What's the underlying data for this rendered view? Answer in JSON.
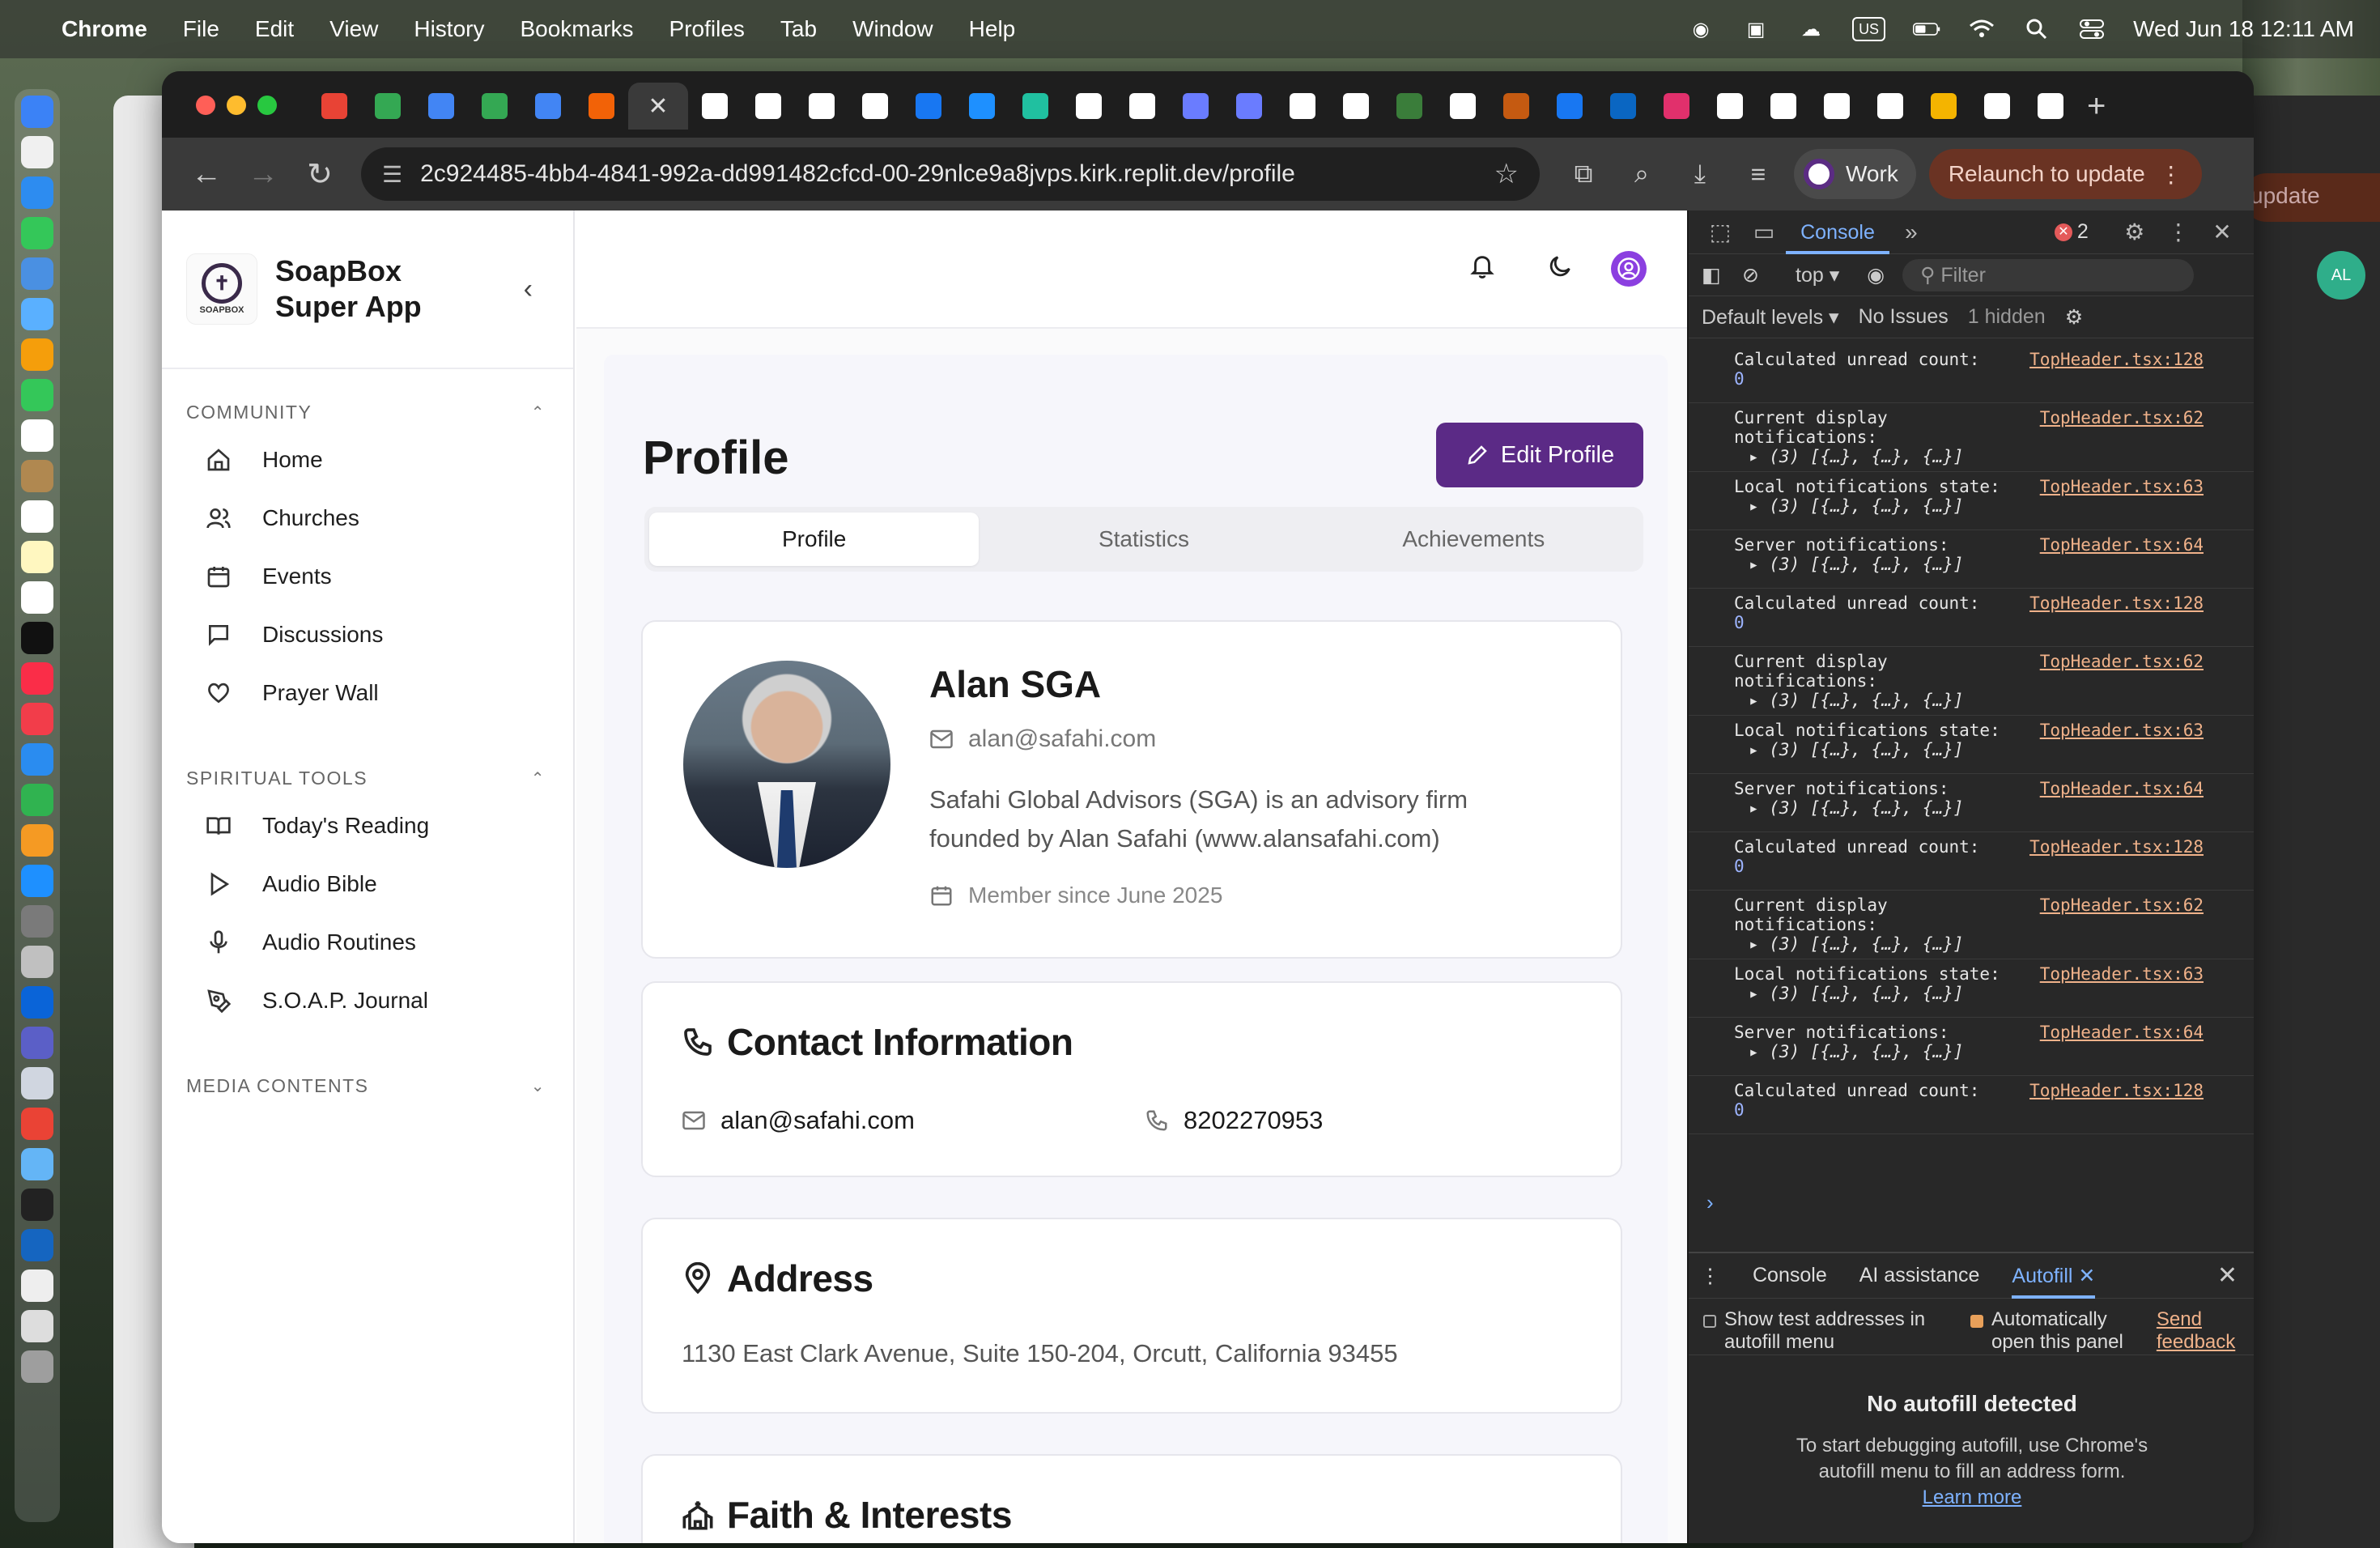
{
  "menubar": {
    "app": "Chrome",
    "items": [
      "File",
      "Edit",
      "View",
      "History",
      "Bookmarks",
      "Profiles",
      "Tab",
      "Window",
      "Help"
    ],
    "input_source": "US",
    "clock": "Wed Jun 18  12:11 AM"
  },
  "browser": {
    "url": "2c924485-4bb4-4841-992a-dd991482cfcd-00-29nlce9a8jvps.kirk.replit.dev/profile",
    "profile_chip": "Work",
    "relaunch": "Relaunch to update",
    "bg_window_update": "update",
    "bg_window_avatar": "AL",
    "tab_icons": [
      "gmail-icon",
      "sheets-icon",
      "docs-icon",
      "sheets-icon",
      "docs-icon",
      "replit-icon",
      "active-tab",
      "chatgpt-icon",
      "github-icon",
      "chatgpt-icon",
      "x-icon",
      "facebook-icon",
      "stack-icon",
      "replit-icon",
      "google-icon",
      "chatgpt-icon",
      "chatgpt-icon",
      "chatgpt-icon",
      "github-icon",
      "google-icon",
      "app-icon",
      "app-icon",
      "app-icon",
      "facebook-icon",
      "linkedin-icon",
      "instagram-icon",
      "google-icon",
      "google-icon",
      "amazon-icon",
      "x-icon",
      "app-icon",
      "chrome-icon",
      "app-icon"
    ],
    "tab_colors": [
      "#e84335",
      "#34a853",
      "#4285f4",
      "#34a853",
      "#4285f4",
      "#f26207",
      "#3a3a3a",
      "#ffffff",
      "#ffffff",
      "#ffffff",
      "#ffffff",
      "#1877f2",
      "#1e90ff",
      "#20c0a0",
      "#ffffff",
      "#ffffff",
      "#6a7cff",
      "#6a7cff",
      "#ffffff",
      "#ffffff",
      "#3a7d3a",
      "#ffffff",
      "#c55a11",
      "#1877f2",
      "#0a66c2",
      "#e1306c",
      "#ffffff",
      "#ffffff",
      "#ffffff",
      "#ffffff",
      "#f4b400",
      "#ffffff",
      "#ffffff"
    ]
  },
  "app": {
    "brand_line1": "SoapBox",
    "brand_line2": "Super App",
    "logo_text": "SOAPBOX",
    "sections": [
      {
        "title": "COMMUNITY",
        "items": [
          "Home",
          "Churches",
          "Events",
          "Discussions",
          "Prayer Wall"
        ]
      },
      {
        "title": "SPIRITUAL TOOLS",
        "items": [
          "Today's Reading",
          "Audio Bible",
          "Audio Routines",
          "S.O.A.P. Journal"
        ]
      },
      {
        "title": "MEDIA CONTENTS",
        "items": []
      }
    ]
  },
  "profile": {
    "page_title": "Profile",
    "edit_button": "Edit Profile",
    "tabs": [
      "Profile",
      "Statistics",
      "Achievements"
    ],
    "name": "Alan SGA",
    "email": "alan@safahi.com",
    "bio": "Safahi Global Advisors (SGA) is an advisory firm founded by Alan Safahi (www.alansafahi.com)",
    "member_since": "Member since June 2025",
    "contact_title": "Contact Information",
    "contact_email": "alan@safahi.com",
    "contact_phone": "8202270953",
    "address_title": "Address",
    "address": "1130 East Clark Avenue, Suite 150-204, Orcutt, California 93455",
    "faith_title": "Faith & Interests"
  },
  "devtools": {
    "tab": "Console",
    "error_count": "2",
    "context": "top",
    "filter_placeholder": "Filter",
    "levels": "Default levels",
    "issues": "No Issues",
    "hidden": "1 hidden",
    "logs": [
      {
        "msg": "Calculated unread count:",
        "src": "TopHeader.tsx:128",
        "val": "0"
      },
      {
        "msg": "Current display\nnotifications:",
        "src": "TopHeader.tsx:62",
        "sub": "▸ (3) [{…}, {…}, {…}]"
      },
      {
        "msg": "Local notifications state:",
        "src": "TopHeader.tsx:63",
        "sub": "▸ (3) [{…}, {…}, {…}]"
      },
      {
        "msg": "Server notifications:",
        "src": "TopHeader.tsx:64",
        "sub": "▸ (3) [{…}, {…}, {…}]"
      },
      {
        "msg": "Calculated unread count:",
        "src": "TopHeader.tsx:128",
        "val": "0"
      },
      {
        "msg": "Current display\nnotifications:",
        "src": "TopHeader.tsx:62",
        "sub": "▸ (3) [{…}, {…}, {…}]"
      },
      {
        "msg": "Local notifications state:",
        "src": "TopHeader.tsx:63",
        "sub": "▸ (3) [{…}, {…}, {…}]"
      },
      {
        "msg": "Server notifications:",
        "src": "TopHeader.tsx:64",
        "sub": "▸ (3) [{…}, {…}, {…}]"
      },
      {
        "msg": "Calculated unread count:",
        "src": "TopHeader.tsx:128",
        "val": "0"
      },
      {
        "msg": "Current display\nnotifications:",
        "src": "TopHeader.tsx:62",
        "sub": "▸ (3) [{…}, {…}, {…}]"
      },
      {
        "msg": "Local notifications state:",
        "src": "TopHeader.tsx:63",
        "sub": "▸ (3) [{…}, {…}, {…}]"
      },
      {
        "msg": "Server notifications:",
        "src": "TopHeader.tsx:64",
        "sub": "▸ (3) [{…}, {…}, {…}]"
      },
      {
        "msg": "Calculated unread count:",
        "src": "TopHeader.tsx:128",
        "val": "0"
      }
    ],
    "drawer_tabs": [
      "Console",
      "AI assistance",
      "Autofill"
    ],
    "autofill": {
      "opt1": "Show test addresses in autofill menu",
      "opt2": "Automatically open this panel",
      "feedback": "Send feedback",
      "empty_title": "No autofill detected",
      "empty_desc": "To start debugging autofill, use Chrome's autofill menu to fill an address form.",
      "learn_more": "Learn more"
    }
  }
}
